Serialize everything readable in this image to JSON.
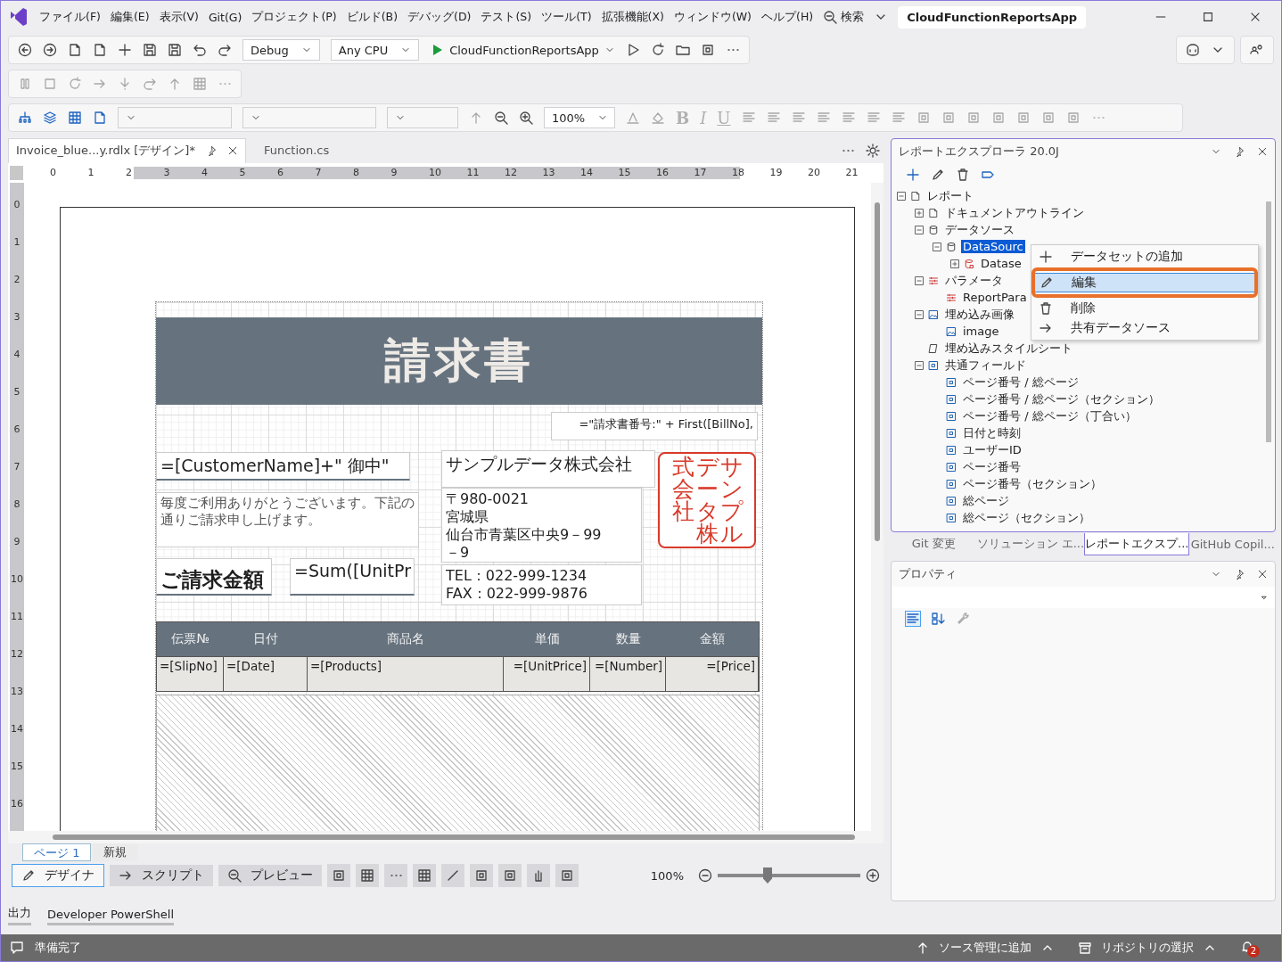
{
  "title_bar": {
    "menu": [
      "ファイル(F)",
      "編集(E)",
      "表示(V)",
      "Git(G)",
      "プロジェクト(P)",
      "ビルド(B)",
      "デバッグ(D)",
      "テスト(S)",
      "ツール(T)",
      "拡張機能(X)",
      "ウィンドウ(W)",
      "ヘルプ(H)"
    ],
    "search": "検索",
    "solution": "CloudFunctionReportsApp"
  },
  "toolbar": {
    "configuration": "Debug",
    "platform": "Any CPU",
    "startup": "CloudFunctionReportsApp"
  },
  "report_toolbar": {
    "zoom": "100%",
    "text_style_buttons": [
      "B",
      "I",
      "U"
    ]
  },
  "document_tabs": [
    {
      "label": "Invoice_blue...y.rdlx [デザイン]*",
      "selected": true
    },
    {
      "label": "Function.cs",
      "selected": false
    }
  ],
  "ruler": {
    "horizontal": [
      "0",
      "1",
      "2",
      "3",
      "4",
      "5",
      "6",
      "7",
      "8",
      "9",
      "10",
      "11",
      "12",
      "13",
      "14",
      "15",
      "16",
      "17",
      "18",
      "19",
      "20",
      "21"
    ],
    "vertical": [
      "0",
      "1",
      "2",
      "3",
      "4",
      "5",
      "6",
      "7",
      "8",
      "9",
      "10",
      "11",
      "12",
      "13",
      "14",
      "15",
      "16"
    ]
  },
  "report": {
    "title": "請求書",
    "bill_no": "=\"請求書番号:\" + First([BillNo],",
    "customer": "=[CustomerName]+\" 御中\"",
    "greeting": "毎度ご利用ありがとうございます。下記の通りご請求申し上げます。",
    "company": "サンプルデータ株式会社",
    "address": [
      "〒980-0021",
      "宮城県",
      "仙台市青葉区中央9－99",
      "－9"
    ],
    "contact": [
      "TEL：022-999-1234",
      "FAX：022-999-9876"
    ],
    "stamp": [
      "式会社",
      "データ株",
      "サンプル"
    ],
    "amount_label": "ご請求金額",
    "amount_value": "=Sum([UnitPr",
    "table": {
      "columns": [
        "伝票№",
        "日付",
        "商品名",
        "単価",
        "数量",
        "金額"
      ],
      "row": [
        "=[SlipNo]",
        "=[Date]",
        "=[Products]",
        "=[UnitPrice]",
        "=[Number]",
        "=[Price]"
      ]
    }
  },
  "designer": {
    "pages": [
      {
        "label": "ページ 1",
        "selected": true
      },
      {
        "label": "新規",
        "selected": false
      }
    ],
    "modes": [
      {
        "label": "デザイナ",
        "selected": true
      },
      {
        "label": "スクリプト",
        "selected": false
      },
      {
        "label": "プレビュー",
        "selected": false
      }
    ],
    "zoom": "100%",
    "zoom_slider": {
      "level": 0.35
    }
  },
  "output_tabs": [
    {
      "label": "出力",
      "selected": false
    },
    {
      "label": "Developer PowerShell",
      "selected": false
    }
  ],
  "report_explorer": {
    "title": "レポートエクスプローラ 20.0J",
    "tree": [
      {
        "label": "レポート",
        "kind": "report",
        "expanded": true,
        "selected": false,
        "children": [
          {
            "label": "ドキュメントアウトライン",
            "kind": "report",
            "expanded": false,
            "selected": false
          },
          {
            "label": "データソース",
            "kind": "database",
            "expanded": true,
            "selected": false,
            "children": [
              {
                "label": "DataSourc",
                "kind": "database",
                "expanded": true,
                "selected": true,
                "children": [
                  {
                    "label": "Datase",
                    "kind": "dataset",
                    "expanded": false,
                    "selected": false
                  }
                ]
              }
            ]
          },
          {
            "label": "パラメータ",
            "kind": "parameters",
            "expanded": true,
            "selected": false,
            "children": [
              {
                "label": "ReportPara",
                "kind": "parameters",
                "selected": false
              }
            ]
          },
          {
            "label": "埋め込み画像",
            "kind": "image",
            "expanded": true,
            "selected": false,
            "children": [
              {
                "label": "image",
                "kind": "image",
                "selected": false
              }
            ]
          },
          {
            "label": "埋め込みスタイルシート",
            "kind": "stylesheet",
            "selected": false
          },
          {
            "label": "共通フィールド",
            "kind": "field",
            "expanded": true,
            "selected": false,
            "children": [
              {
                "label": "ページ番号 / 総ページ",
                "kind": "field",
                "selected": false
              },
              {
                "label": "ページ番号 / 総ページ（セクション）",
                "kind": "field",
                "selected": false
              },
              {
                "label": "ページ番号 / 総ページ（丁合い）",
                "kind": "field",
                "selected": false
              },
              {
                "label": "日付と時刻",
                "kind": "field",
                "selected": false
              },
              {
                "label": "ユーザーID",
                "kind": "field",
                "selected": false
              },
              {
                "label": "ページ番号",
                "kind": "field",
                "selected": false
              },
              {
                "label": "ページ番号（セクション）",
                "kind": "field",
                "selected": false
              },
              {
                "label": "総ページ",
                "kind": "field",
                "selected": false
              },
              {
                "label": "総ページ（セクション）",
                "kind": "field",
                "selected": false
              }
            ]
          }
        ]
      }
    ],
    "context_menu": [
      {
        "label": "データセットの追加",
        "kind": "add",
        "selected": false
      },
      {
        "label": "編集",
        "kind": "edit",
        "selected": true
      },
      {
        "label": "削除",
        "kind": "delete",
        "selected": false
      },
      {
        "label": "共有データソース",
        "kind": "shared",
        "selected": false
      }
    ],
    "tabs": [
      {
        "label": "Git 変更",
        "selected": false
      },
      {
        "label": "ソリューション エ...",
        "selected": false
      },
      {
        "label": "レポートエクスプ...",
        "selected": true
      },
      {
        "label": "GitHub Copil...",
        "selected": false
      }
    ]
  },
  "properties": {
    "title": "プロパティ"
  },
  "status_bar": {
    "message": "準備完了",
    "source_control": "ソース管理に追加",
    "repository": "リポジトリの選択",
    "notifications": "2"
  }
}
